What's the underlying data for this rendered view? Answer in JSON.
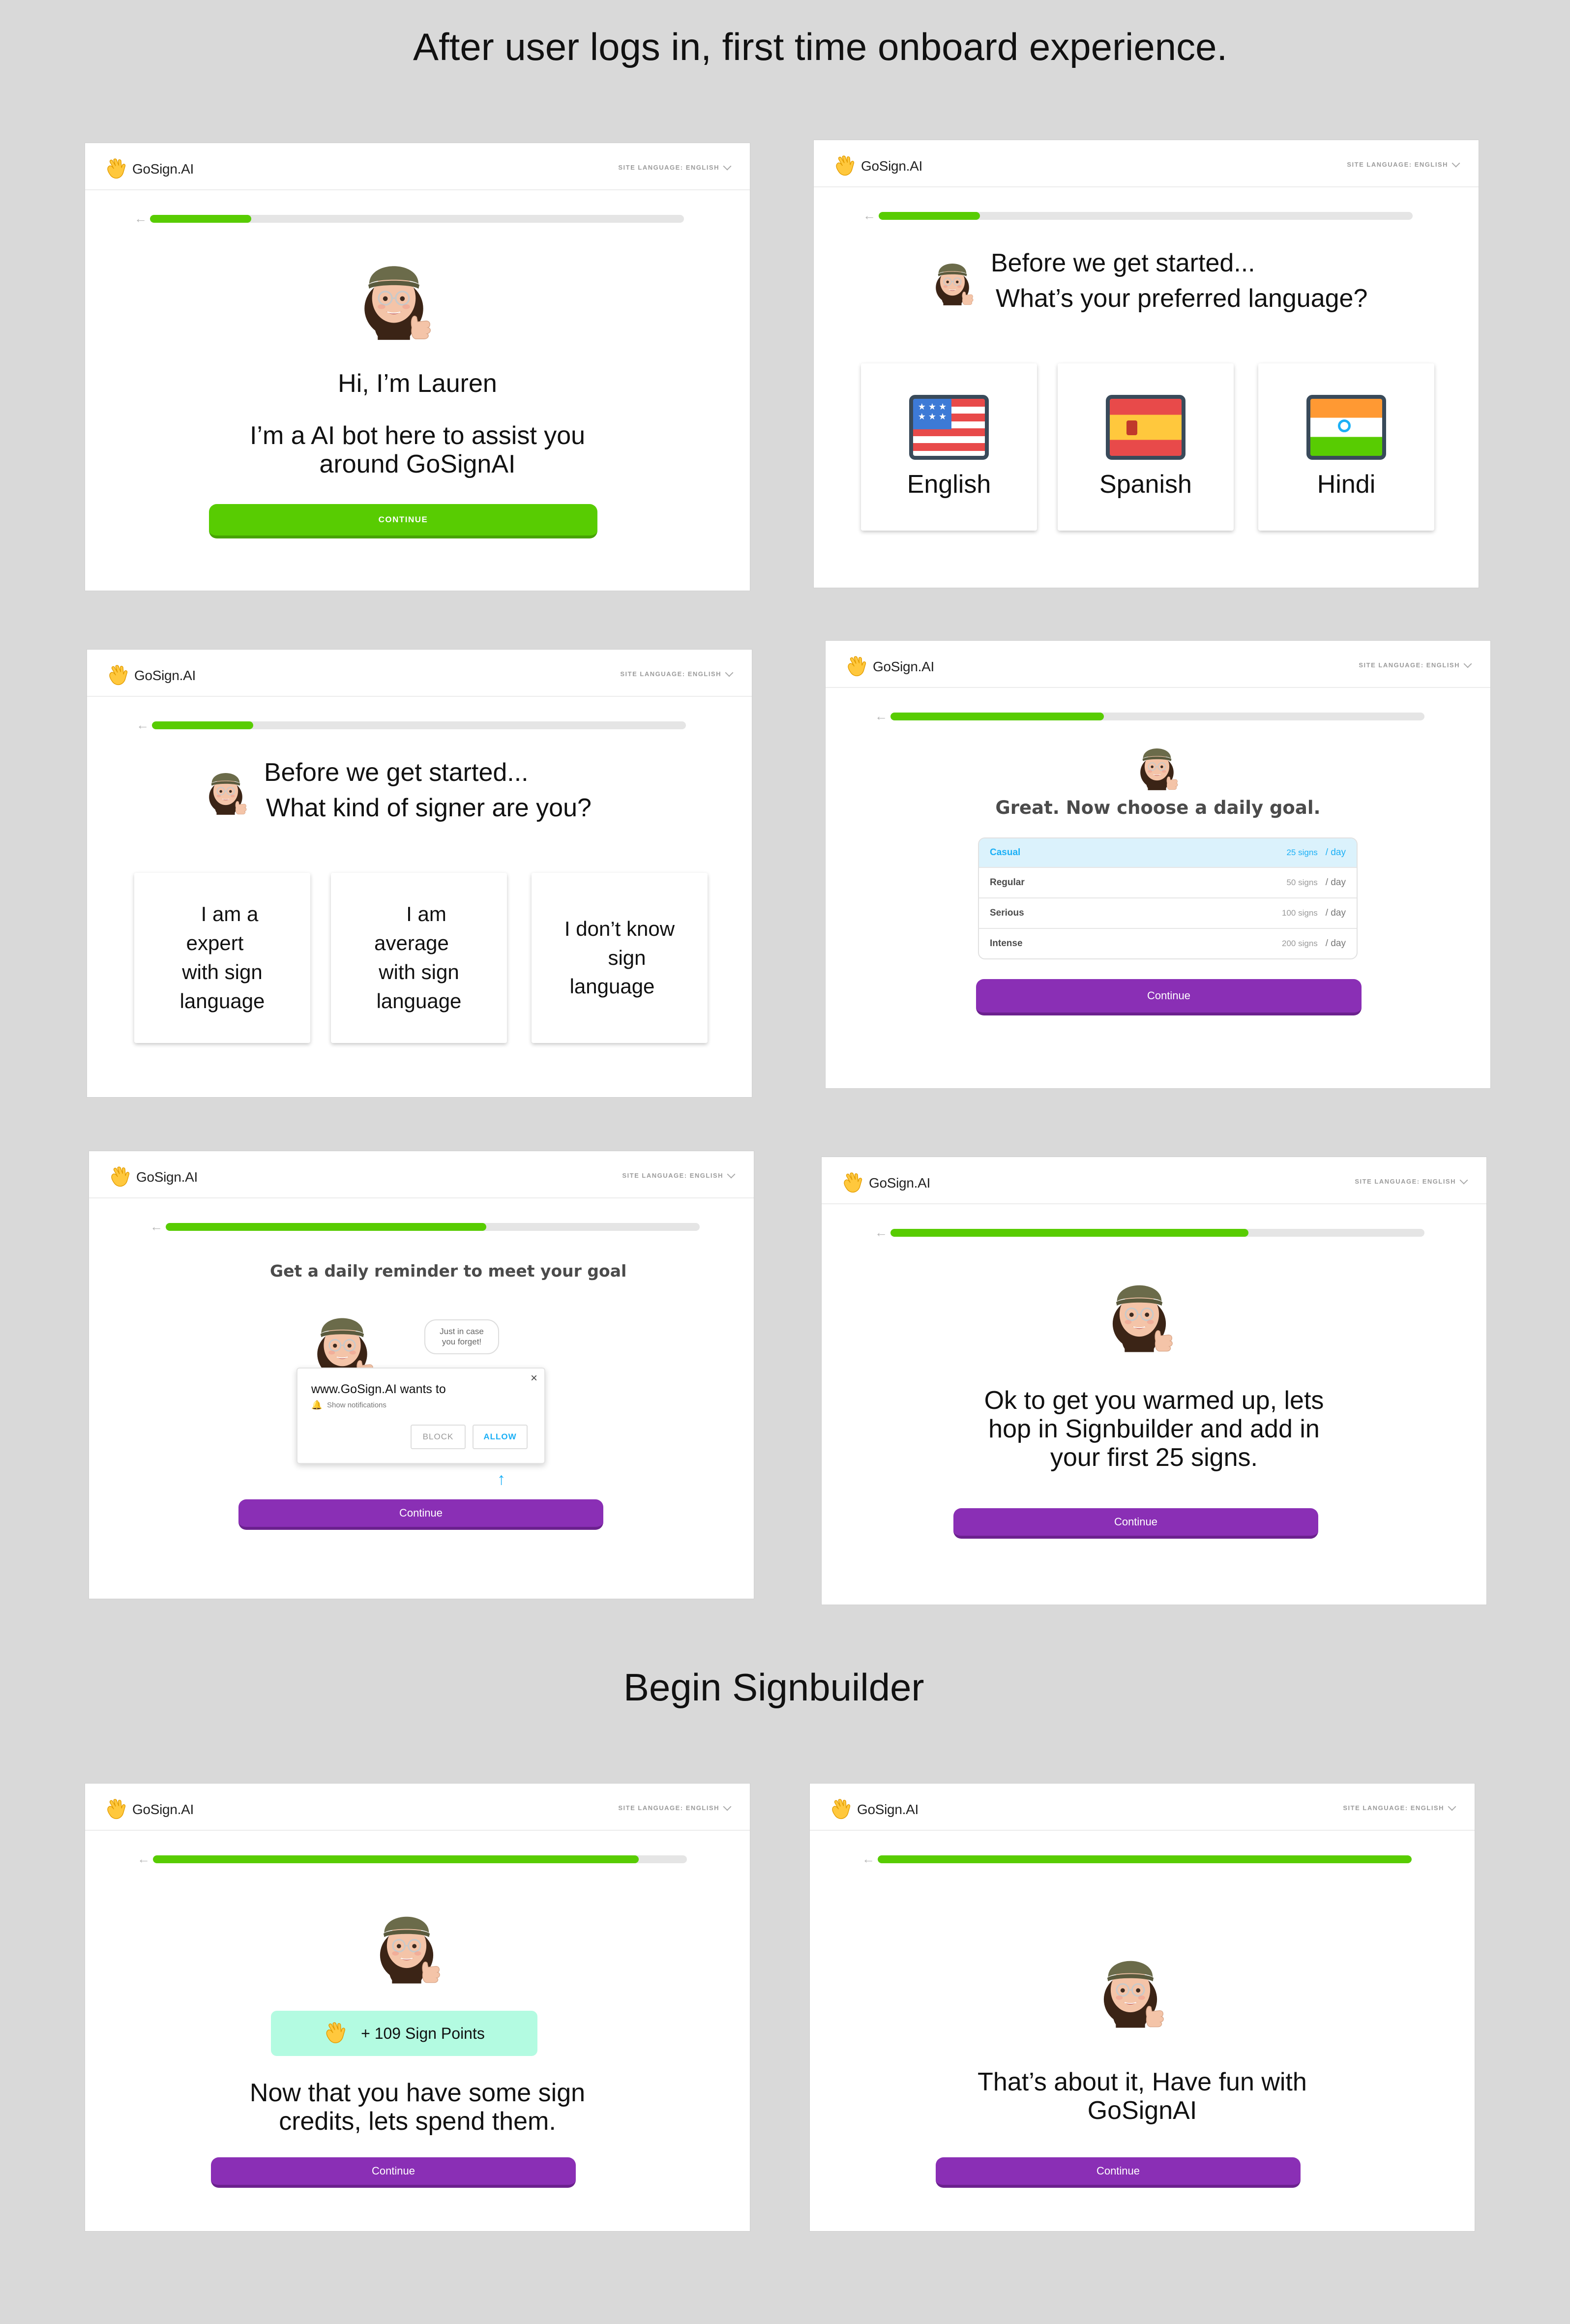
{
  "headings": {
    "onboard": "After user logs in, first time onboard experience.",
    "signbuilder": "Begin Signbuilder"
  },
  "common": {
    "logo_text": "GoSign.AI",
    "site_language": "SITE LANGUAGE: ENGLISH",
    "back_icon": "arrow-left-icon",
    "logo_icon": "waving-hand-icon",
    "accent_green": "#58cc02",
    "accent_purple": "#8a2fb5"
  },
  "screens": {
    "intro": {
      "progress": 0.19,
      "line1": "Hi, I’m Lauren",
      "line2a": "I’m a AI bot here to assist you",
      "line2b": "around GoSignAI",
      "button": "CONTINUE"
    },
    "language": {
      "progress": 0.19,
      "q1": "Before we get started...",
      "q2": "What’s your preferred language?",
      "options": [
        "English",
        "Spanish",
        "Hindi"
      ]
    },
    "signer": {
      "progress": 0.19,
      "q1": "Before we get started...",
      "q2": "What kind of signer are you?",
      "options": [
        {
          "l1": "I am a expert",
          "l2": "with sign",
          "l3": "language"
        },
        {
          "l1": "I am average",
          "l2": "with sign",
          "l3": "language"
        },
        {
          "l1": "I don’t know",
          "l2": "sign language"
        }
      ]
    },
    "goal": {
      "progress": 0.4,
      "title": "Great. Now choose a daily goal.",
      "per_day": "/ day",
      "goals": [
        {
          "name": "Casual",
          "signs": "25 signs"
        },
        {
          "name": "Regular",
          "signs": "50 signs"
        },
        {
          "name": "Serious",
          "signs": "100 signs"
        },
        {
          "name": "Intense",
          "signs": "200 signs"
        }
      ],
      "button": "Continue"
    },
    "reminder": {
      "progress": 0.6,
      "title": "Get a daily reminder to meet your goal",
      "bubble_l1": "Just in case",
      "bubble_l2": "you forget!",
      "notif_title": "www.GoSign.AI wants to",
      "notif_sub": "Show notifications",
      "block": "BLOCK",
      "allow": "ALLOW",
      "button": "Continue"
    },
    "warmup": {
      "progress": 0.67,
      "l1": "Ok to get you warmed up, lets",
      "l2": "hop in Signbuilder and add in",
      "l3": "your first 25 signs.",
      "button": "Continue"
    },
    "points": {
      "progress": 0.91,
      "badge": "+ 109 Sign Points",
      "l1": "Now that you have some sign",
      "l2": "credits, lets spend them.",
      "button": "Continue"
    },
    "final": {
      "progress": 1.0,
      "l1": "That’s about it, Have fun with",
      "l2": "GoSignAI",
      "button": "Continue"
    }
  }
}
